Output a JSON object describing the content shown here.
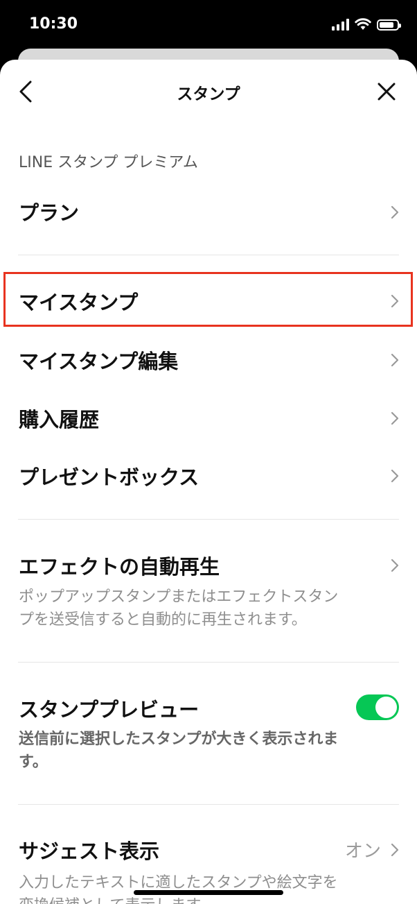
{
  "status_bar": {
    "time": "10:30"
  },
  "header": {
    "title": "スタンプ"
  },
  "section_label": "LINE スタンプ プレミアム",
  "rows": {
    "plan": "プラン",
    "my_stamp": "マイスタンプ",
    "my_stamp_edit": "マイスタンプ編集",
    "purchase_history": "購入履歴",
    "present_box": "プレゼントボックス",
    "effect_autoplay": "エフェクトの自動再生",
    "effect_autoplay_desc_1": "ポップアップスタンプまたはエフェクトスタン",
    "effect_autoplay_desc_2": "プを送受信すると自動的に再生されます。",
    "stamp_preview": "スタンププレビュー",
    "stamp_preview_desc_1": "送信前に選択したスタンプが大きく表示されま",
    "stamp_preview_desc_2": "す。",
    "suggest": "サジェスト表示",
    "suggest_value": "オン",
    "suggest_desc_1": "入力したテキストに適したスタンプや絵文字を",
    "suggest_desc_2": "変換候補として表示します。"
  },
  "toggles": {
    "stamp_preview_on": true
  },
  "colors": {
    "accent_green": "#06c755",
    "highlight_red": "#e8331f"
  }
}
